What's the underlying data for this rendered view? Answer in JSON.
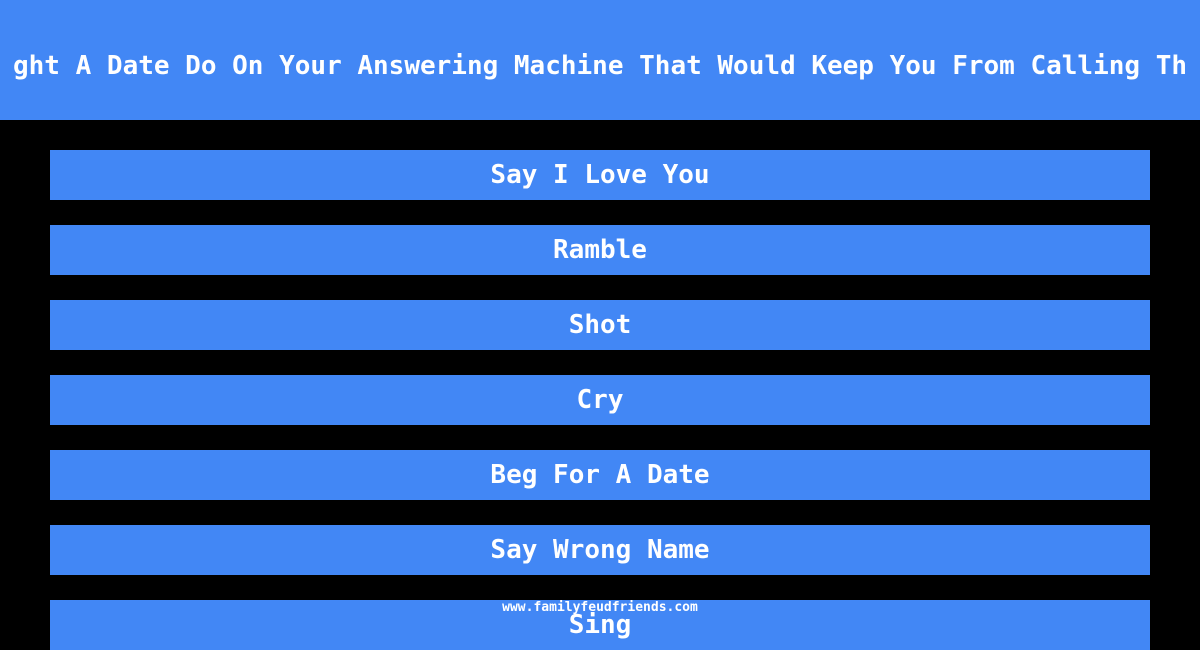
{
  "question": {
    "title": "ght A Date Do On Your Answering Machine That Would Keep You From Calling Th"
  },
  "answers": [
    {
      "label": "Say I Love You"
    },
    {
      "label": "Ramble"
    },
    {
      "label": "Shot"
    },
    {
      "label": "Cry"
    },
    {
      "label": "Beg For A Date"
    },
    {
      "label": "Say Wrong Name"
    },
    {
      "label": "Sing"
    }
  ],
  "footer": {
    "watermark": "www.familyfeudfriends.com"
  },
  "colors": {
    "accent": "#4287f5",
    "background": "#000000",
    "text": "#ffffff"
  }
}
